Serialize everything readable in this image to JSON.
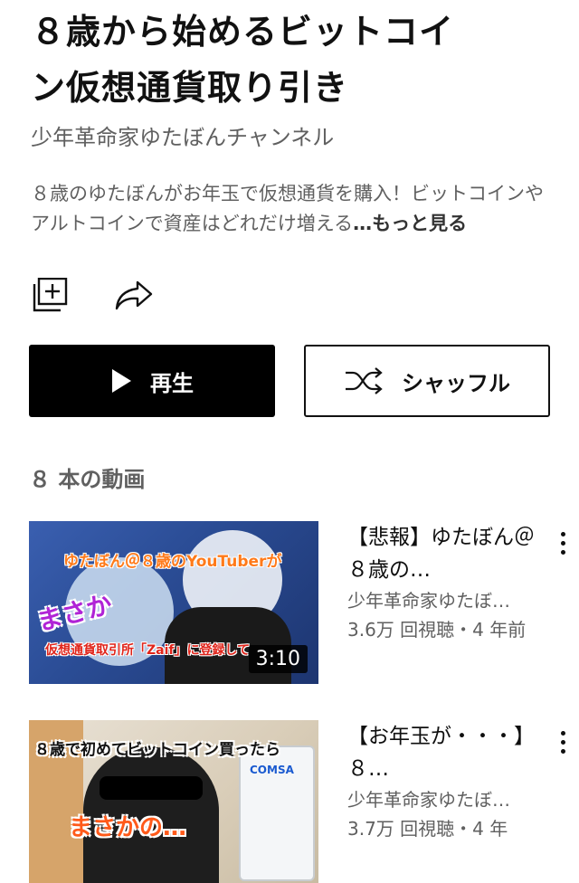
{
  "playlist": {
    "title_line1": "８歳から始めるビットコイ",
    "title_line2": "ン仮想通貨取り引き",
    "channel": "少年革命家ゆたぼんチャンネル",
    "description": "８歳のゆたぼんがお年玉で仮想通貨を購入！ビットコインやアルトコインで資産はどれだけ増える",
    "description_ellipsis": "…",
    "more_label": "もっと見る"
  },
  "actions": {
    "play_label": "再生",
    "shuffle_label": "シャッフル"
  },
  "video_count": "８ 本の動画",
  "videos": [
    {
      "title": "【悲報】ゆたぼん＠８歳の…",
      "channel": "少年革命家ゆたぼ…",
      "stats": "3.6万 回視聴・4 年前",
      "duration": "3:10",
      "thumb_text_top": "ゆたぼん＠８歳のYouTuberが",
      "thumb_text_mid": "まさか",
      "thumb_text_bottom": "仮想通貨取引所「Zaif」に登録して"
    },
    {
      "title": "【お年玉が・・・】８…",
      "channel": "少年革命家ゆたぼ…",
      "stats": "3.7万 回視聴・4 年",
      "thumb_text_top": "８歳で初めてビットコイン買ったら",
      "thumb_text_mid": "まさかの…",
      "thumb_text_app": "COMSA"
    }
  ],
  "colors": {
    "primary_button": "#000000",
    "secondary_text": "#606060"
  },
  "icons": [
    "add-to-library-icon",
    "share-icon",
    "play-icon",
    "shuffle-icon",
    "more-vert-icon"
  ]
}
